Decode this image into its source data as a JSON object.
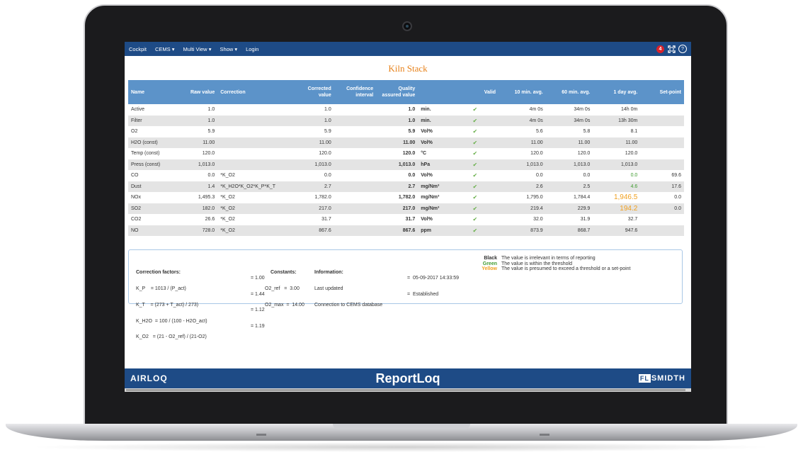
{
  "nav": {
    "items": [
      "Cockpit",
      "CEMS",
      "Multi View",
      "Show",
      "Login"
    ],
    "notifications": "4",
    "expand_icon": "fullscreen-icon",
    "help_label": "?"
  },
  "page_title": "Kiln Stack",
  "table": {
    "headers": {
      "name": "Name",
      "raw": "Raw value",
      "correction": "Correction",
      "corrected": "Corrected value",
      "ci": "Confidence interval",
      "qav": "Quality assured value",
      "unit": "",
      "valid": "Valid",
      "avg10": "10 min. avg.",
      "avg60": "60 min. avg.",
      "avgday": "1 day avg.",
      "setpoint": "Set-point"
    },
    "rows": [
      {
        "name": "Active",
        "raw": "1.0",
        "correction": "",
        "corrected": "1.0",
        "ci": "",
        "qav": "1.0",
        "unit": "min.",
        "avg10": "4m 0s",
        "avg60": "34m 0s",
        "avgday": "14h 0m",
        "setpoint": ""
      },
      {
        "name": "Filter",
        "raw": "1.0",
        "correction": "",
        "corrected": "1.0",
        "ci": "",
        "qav": "1.0",
        "unit": "min.",
        "avg10": "4m 0s",
        "avg60": "34m 0s",
        "avgday": "13h 30m",
        "setpoint": ""
      },
      {
        "name": "O2",
        "raw": "5.9",
        "correction": "",
        "corrected": "5.9",
        "ci": "",
        "qav": "5.9",
        "unit": "Vol%",
        "avg10": "5.6",
        "avg60": "5.8",
        "avgday": "8.1",
        "setpoint": ""
      },
      {
        "name": "H2O (const)",
        "raw": "11.00",
        "correction": "",
        "corrected": "11.00",
        "ci": "",
        "qav": "11.00",
        "unit": "Vol%",
        "avg10": "11.00",
        "avg60": "11.00",
        "avgday": "11.00",
        "setpoint": ""
      },
      {
        "name": "Temp (const)",
        "raw": "120.0",
        "correction": "",
        "corrected": "120.0",
        "ci": "",
        "qav": "120.0",
        "unit": "°C",
        "avg10": "120.0",
        "avg60": "120.0",
        "avgday": "120.0",
        "setpoint": ""
      },
      {
        "name": "Press (const)",
        "raw": "1,013.0",
        "correction": "",
        "corrected": "1,013.0",
        "ci": "",
        "qav": "1,013.0",
        "unit": "hPa",
        "avg10": "1,013.0",
        "avg60": "1,013.0",
        "avgday": "1,013.0",
        "setpoint": ""
      },
      {
        "name": "CO",
        "raw": "0.0",
        "correction": "*K_O2",
        "corrected": "0.0",
        "ci": "",
        "qav": "0.0",
        "unit": "Vol%",
        "avg10": "0.0",
        "avg60": "0.0",
        "avgday": "0.0",
        "avgday_status": "green",
        "setpoint": "69.6"
      },
      {
        "name": "Dust",
        "raw": "1.4",
        "correction": "*K_H2O*K_O2*K_P*K_T",
        "corrected": "2.7",
        "ci": "",
        "qav": "2.7",
        "unit": "mg/Nm³",
        "avg10": "2.6",
        "avg60": "2.5",
        "avgday": "4.6",
        "avgday_status": "green",
        "setpoint": "17.6"
      },
      {
        "name": "NOx",
        "raw": "1,495.3",
        "correction": "*K_O2",
        "corrected": "1,782.0",
        "ci": "",
        "qav": "1,782.0",
        "unit": "mg/Nm³",
        "avg10": "1,795.0",
        "avg60": "1,784.4",
        "avgday": "1,946.5",
        "avgday_status": "yellow",
        "setpoint": "0.0"
      },
      {
        "name": "SO2",
        "raw": "182.0",
        "correction": "*K_O2",
        "corrected": "217.0",
        "ci": "",
        "qav": "217.0",
        "unit": "mg/Nm³",
        "avg10": "219.4",
        "avg60": "229.9",
        "avgday": "194.2",
        "avgday_status": "yellow",
        "setpoint": "0.0"
      },
      {
        "name": "CO2",
        "raw": "26.6",
        "correction": "*K_O2",
        "corrected": "31.7",
        "ci": "",
        "qav": "31.7",
        "unit": "Vol%",
        "avg10": "32.0",
        "avg60": "31.9",
        "avgday": "32.7",
        "setpoint": ""
      },
      {
        "name": "NO",
        "raw": "728.0",
        "correction": "*K_O2",
        "corrected": "867.6",
        "ci": "",
        "qav": "867.6",
        "unit": "ppm",
        "avg10": "873.9",
        "avg60": "868.7",
        "avgday": "947.6",
        "setpoint": ""
      }
    ],
    "valid_icon": "checkmark-icon",
    "colors": {
      "header": "#5c93c9",
      "alt_row": "#e4e4e4",
      "green": "#3f9b2f",
      "yellow": "#f0a020"
    }
  },
  "info": {
    "correction_title": "Correction factors:",
    "correction_lines": [
      "K_P    = 1013 / (P_act)",
      "K_T    = (273 + T_act) / 273)",
      "K_H2O  = 100 / (100 - H2O_act)",
      "K_O2   = (21 - O2_ref) / (21-O2)"
    ],
    "correction_values": [
      "= 1.00",
      "= 1.44",
      "= 1.12",
      "= 1.19"
    ],
    "constants_title": "Constants:",
    "constants_lines": [
      "O2_ref   =  3.00",
      "O2_max  =  14.00"
    ],
    "information_title": "Information:",
    "information_lines": [
      "Last updated",
      "Connection to CEMS database"
    ],
    "information_values": [
      "=  05-09-2017 14:33:59",
      "=  Established"
    ],
    "legend": [
      {
        "label": "Black",
        "text": "The value is irrelevant in terms of reporting",
        "color": "#333333"
      },
      {
        "label": "Green",
        "text": "The value is within the threshold",
        "color": "#3f9b2f"
      },
      {
        "label": "Yellow",
        "text": "The value is presumed to exceed a threshold or a set-point",
        "color": "#f0a020"
      }
    ]
  },
  "footer": {
    "left_logo": "AIRLOQ",
    "center": "ReportLoq",
    "right_logo_box": "FL",
    "right_logo_text": "SMIDTH"
  }
}
